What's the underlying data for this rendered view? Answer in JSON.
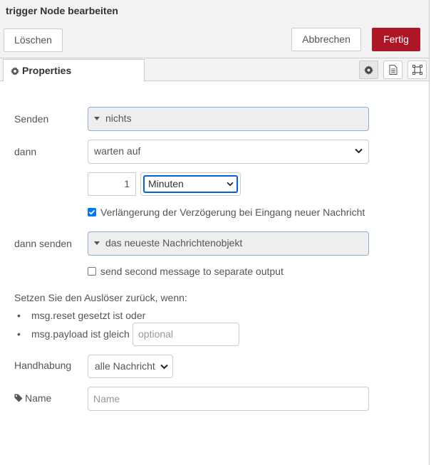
{
  "header": {
    "title": "trigger Node bearbeiten"
  },
  "toolbar": {
    "delete_label": "Löschen",
    "cancel_label": "Abbrechen",
    "done_label": "Fertig",
    "done_color": "#ad1625"
  },
  "tabs": {
    "properties_label": "Properties",
    "icons": [
      "gear-icon",
      "document-icon",
      "frame-icon"
    ]
  },
  "form": {
    "send_label": "Senden",
    "send_value": "nichts",
    "then_label": "dann",
    "then_value": "warten auf",
    "duration_value": "1",
    "duration_unit": "Minuten",
    "extend_checked": true,
    "extend_label": "Verlängerung der Verzögerung bei Eingang neuer Nachricht",
    "then_send_label": "dann senden",
    "then_send_value": "das neueste Nachrichtenobjekt",
    "second_output_checked": false,
    "second_output_label": "send second message to separate output",
    "reset_heading": "Setzen Sie den Auslöser zurück, wenn:",
    "reset_item1": "msg.reset gesetzt ist oder",
    "reset_item2": "msg.payload ist gleich",
    "reset_payload_placeholder": "optional",
    "handling_label": "Handhabung",
    "handling_value": "alle Nachricht",
    "name_label": "Name",
    "name_placeholder": "Name"
  }
}
